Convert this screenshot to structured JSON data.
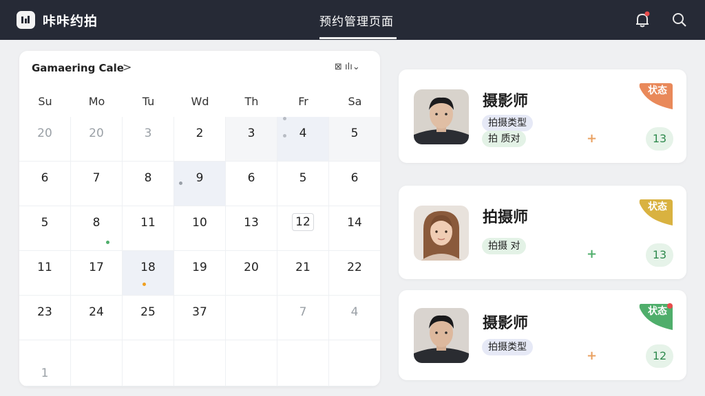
{
  "app": {
    "name": "咔咔约拍",
    "page_title": "预约管理页面"
  },
  "icons": {
    "logo": "camera-app-logo-icon",
    "bell": "bell-icon",
    "search": "search-icon",
    "next": "chevron-right-icon",
    "view": "calendar-view-icon"
  },
  "calendar": {
    "title": "Gamaering Cale",
    "next_symbol": ">",
    "view_label": "⊠ ılı⌄",
    "weekdays": [
      "Su",
      "Mo",
      "Tu",
      "Wd",
      "Th",
      "Fr",
      "Sa"
    ],
    "rows": [
      [
        "20",
        "20",
        "3",
        "2",
        "3",
        "4",
        "5"
      ],
      [
        "6",
        "7",
        "8",
        "9",
        "6",
        "5",
        "6"
      ],
      [
        "5",
        "8",
        "11",
        "10",
        "13",
        "12",
        "14"
      ],
      [
        "11",
        "17",
        "18",
        "19",
        "20",
        "21",
        "22"
      ],
      [
        "23",
        "24",
        "25",
        "37",
        "",
        "7",
        "4"
      ],
      [
        "1",
        "",
        "",
        "",
        "",
        "",
        ""
      ]
    ]
  },
  "photographers": [
    {
      "name": "摄影师",
      "tags": [
        "拍摄类型",
        "拍 质对"
      ],
      "plus": "+",
      "count": "13",
      "status": "状态",
      "status_color": "#e9895a"
    },
    {
      "name": "拍摄师",
      "tags": [
        "拍摄 对"
      ],
      "plus": "+",
      "count": "13",
      "status": "状态",
      "status_color": "#d9b240"
    },
    {
      "name": "摄影师",
      "tags": [
        "拍摄类型"
      ],
      "plus": "+",
      "count": "12",
      "status": "状态",
      "status_color": "#4fae6b"
    }
  ],
  "colors": {
    "topbar": "#262a36",
    "plus_orange": "#e9a060",
    "plus_green": "#4fae6b"
  }
}
